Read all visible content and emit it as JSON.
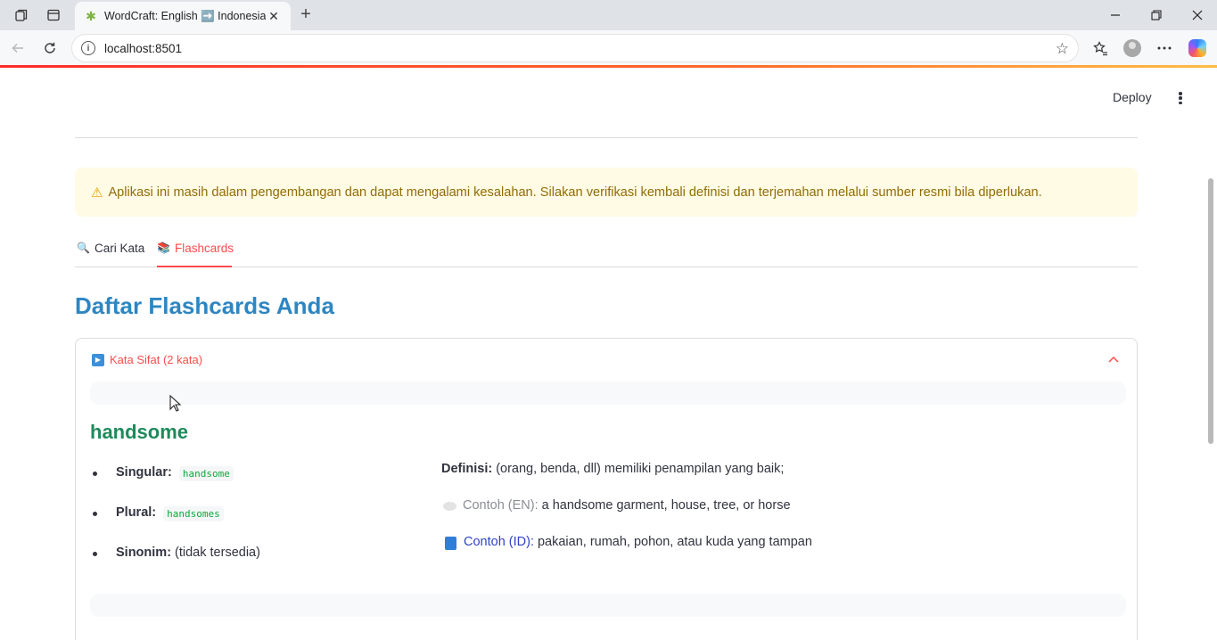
{
  "browser": {
    "tab_title": "WordCraft: English ➡️ Indonesia",
    "url": "localhost:8501",
    "new_tab_symbol": "+",
    "close_symbol": "✕"
  },
  "app": {
    "deploy_label": "Deploy",
    "warning_text": "Aplikasi ini masih dalam pengembangan dan dapat mengalami kesalahan. Silakan verifikasi kembali definisi dan terjemahan melalui sumber resmi bila diperlukan.",
    "tabs": [
      {
        "icon": "🔍",
        "label": "Cari Kata",
        "active": false
      },
      {
        "icon": "📚",
        "label": "Flashcards",
        "active": true
      }
    ],
    "page_title": "Daftar Flashcards Anda",
    "expander": {
      "label": "Kata Sifat (2 kata)",
      "expanded": true
    },
    "word": {
      "title": "handsome",
      "singular_label": "Singular:",
      "singular_value": "handsome",
      "plural_label": "Plural:",
      "plural_value": "handsomes",
      "synonym_label": "Sinonim:",
      "synonym_value": "(tidak tersedia)",
      "definition_label": "Definisi:",
      "definition_value": "(orang, benda, dll) memiliki penampilan yang baik;",
      "example_en_label": "Contoh (EN):",
      "example_en_value": "a handsome garment, house, tree, or horse",
      "example_id_label": "Contoh (ID):",
      "example_id_value": "pakaian, rumah, pohon, atau kuda yang tampan"
    }
  },
  "colors": {
    "accent_red": "#ff4b4b",
    "title_blue": "#2e86c1",
    "word_green": "#1e8a5a",
    "warning_bg": "#fffbe5",
    "warning_text": "#926c05"
  }
}
